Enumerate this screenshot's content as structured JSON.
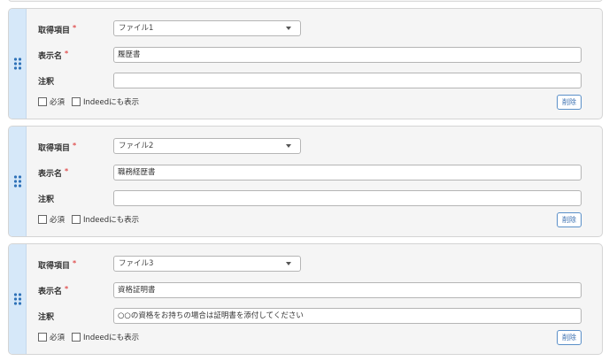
{
  "labels": {
    "item": "取得項目",
    "display_name": "表示名",
    "note": "注釈",
    "required_mark": "*",
    "required_checkbox": "必須",
    "indeed_checkbox": "Indeedにも表示",
    "delete_button": "削除"
  },
  "cards": [
    {
      "item_value": "ファイル1",
      "display_name_value": "履歴書",
      "note_value": ""
    },
    {
      "item_value": "ファイル2",
      "display_name_value": "職務経歴書",
      "note_value": ""
    },
    {
      "item_value": "ファイル3",
      "display_name_value": "資格証明書",
      "note_value": "○○の資格をお持ちの場合は証明書を添付してください"
    }
  ],
  "colors": {
    "card_background": "#f5f5f5",
    "handle_background": "#d6e8f9",
    "handle_dots": "#2f72b8",
    "required_mark": "#e05050",
    "button_border": "#5a8fc8"
  },
  "icons": {
    "drag_handle": "drag-handle-icon",
    "select_caret": "chevron-down-icon"
  }
}
